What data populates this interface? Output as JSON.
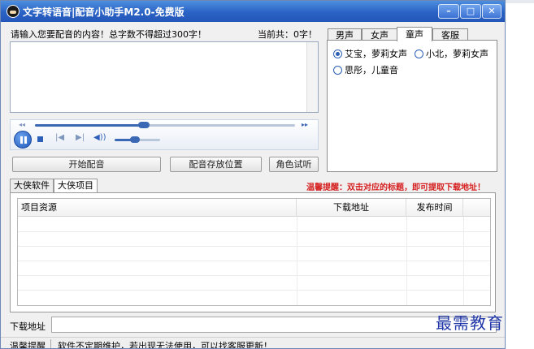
{
  "window": {
    "title": "文字转语音|配音小助手M2.0-免费版",
    "minimize_glyph": "–",
    "maximize_glyph": "□",
    "close_glyph": "✕"
  },
  "input": {
    "prompt": "请输入您要配音的内容！总字数不得超过300字！",
    "count_label": "当前共：0字！",
    "value": ""
  },
  "player": {
    "progress": 0.42,
    "volume": 0.45,
    "rewind_glyph": "◂◂",
    "forward_glyph": "▸▸",
    "prev_glyph": "|◀",
    "next_glyph": "▶|",
    "volume_glyph": "◀))"
  },
  "buttons": {
    "start": "开始配音",
    "location": "配音存放位置",
    "trial": "角色试听"
  },
  "voice_tabs": [
    {
      "label": "男声",
      "active": false
    },
    {
      "label": "女声",
      "active": false
    },
    {
      "label": "童声",
      "active": true
    },
    {
      "label": "客服",
      "active": false
    }
  ],
  "voices": [
    {
      "label": "艾宝，萝莉女声",
      "checked": true
    },
    {
      "label": "小北，萝莉女声",
      "checked": false
    },
    {
      "label": "思彤，儿童音",
      "checked": false
    }
  ],
  "page_tabs": [
    {
      "label": "大侠软件",
      "active": false
    },
    {
      "label": "大侠项目",
      "active": true
    }
  ],
  "tip": "温馨提醒：双击对应的标题，即可提取下载地址！",
  "table": {
    "columns": [
      "项目资源",
      "下载地址",
      "发布时间",
      ""
    ]
  },
  "download": {
    "label": "下载地址",
    "value": ""
  },
  "status": {
    "label": "温馨提醒",
    "message": "软件不定期维护，若出现无法使用，可以找客服更新！"
  },
  "watermark": "最需教育",
  "colors": {
    "title_bar": "#2a62c5",
    "accent": "#2c5fb7",
    "tip_red": "#d62020",
    "watermark": "#2238a8"
  }
}
